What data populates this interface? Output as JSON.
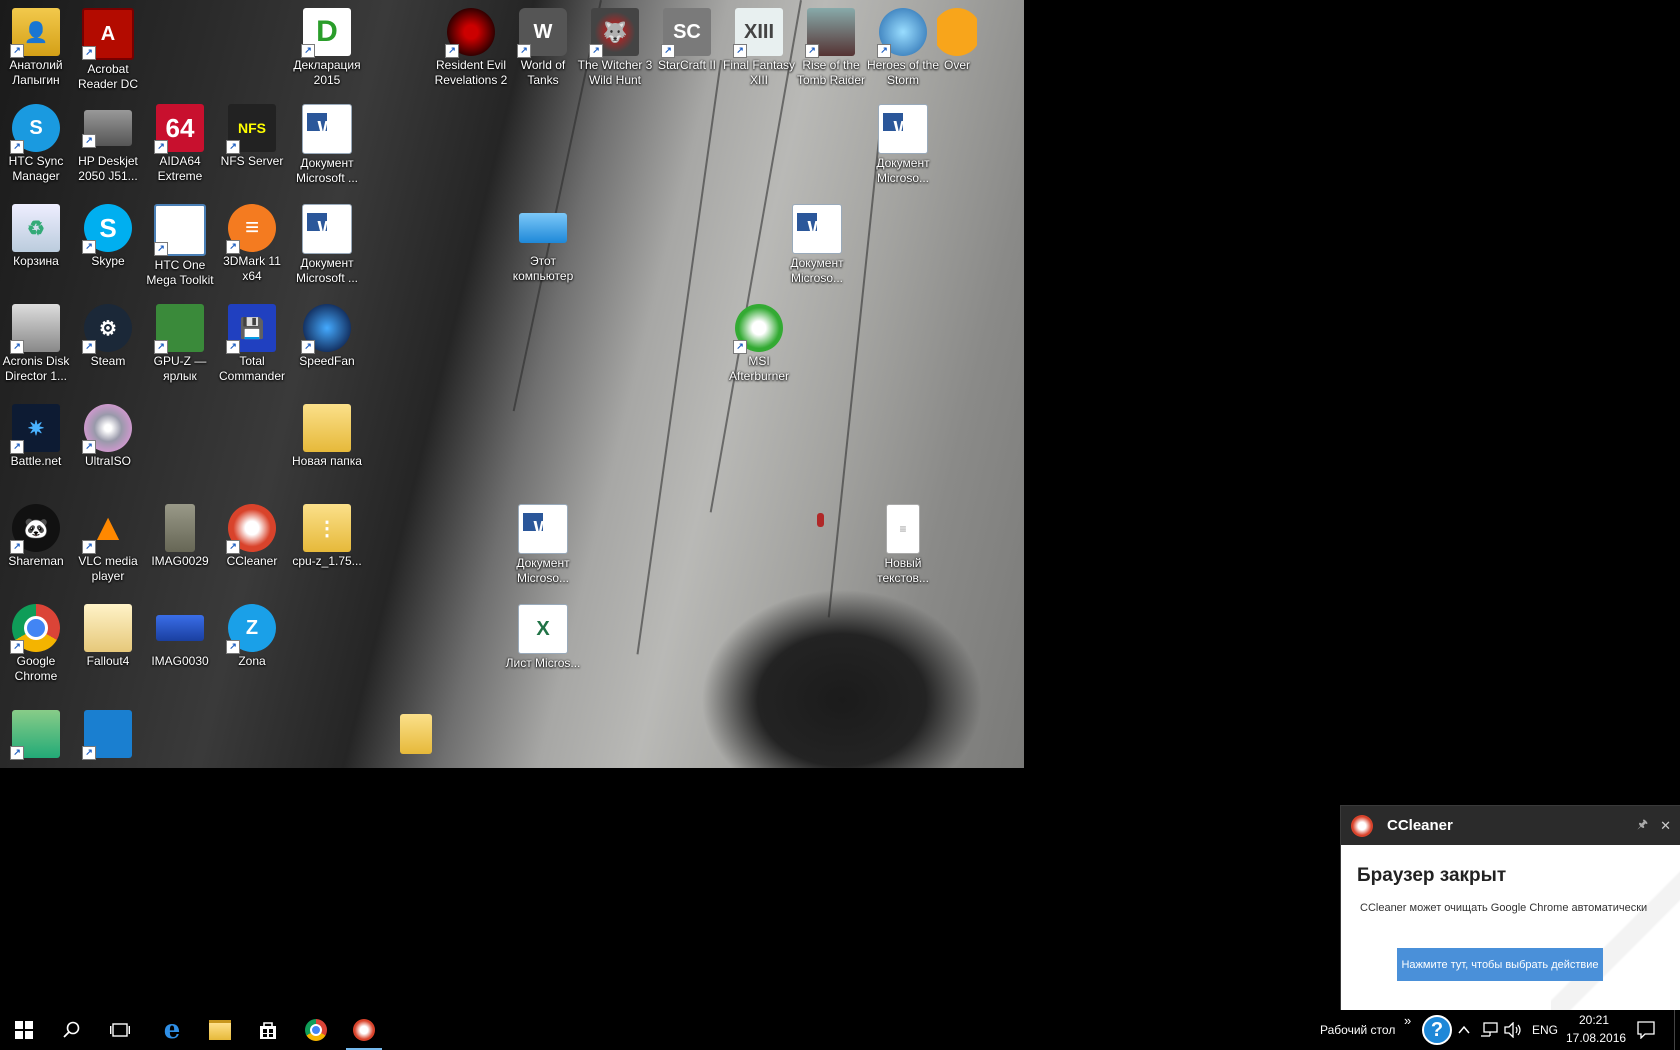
{
  "desktop": {
    "icons": [
      {
        "label": "Анатолий Лапыгин",
        "icon": "user-folder-icon"
      },
      {
        "label": "Acrobat Reader DC",
        "icon": "acrobat-icon"
      },
      {
        "label": "Декларация 2015",
        "icon": "declaration-icon"
      },
      {
        "label": "Resident Evil Revelations 2",
        "icon": "resident-evil-icon"
      },
      {
        "label": "World of Tanks",
        "icon": "world-of-tanks-icon"
      },
      {
        "label": "The Witcher 3 Wild Hunt",
        "icon": "witcher-icon"
      },
      {
        "label": "StarCraft II",
        "icon": "starcraft-icon"
      },
      {
        "label": "Final Fantasy XIII",
        "icon": "final-fantasy-icon"
      },
      {
        "label": "Rise of the Tomb Raider",
        "icon": "tomb-raider-icon"
      },
      {
        "label": "Heroes of the Storm",
        "icon": "heroes-of-the-storm-icon"
      },
      {
        "label": "Over",
        "icon": "overwatch-icon"
      },
      {
        "label": "HTC Sync Manager",
        "icon": "htc-sync-icon"
      },
      {
        "label": "HP Deskjet 2050 J51...",
        "icon": "printer-icon"
      },
      {
        "label": "AIDA64 Extreme",
        "icon": "aida64-icon"
      },
      {
        "label": "NFS Server",
        "icon": "nfs-server-icon"
      },
      {
        "label": "Документ Microsoft ...",
        "icon": "word-document-icon"
      },
      {
        "label": "Документ Microso...",
        "icon": "word-document-icon"
      },
      {
        "label": "Корзина",
        "icon": "recycle-bin-icon"
      },
      {
        "label": "Skype",
        "icon": "skype-icon"
      },
      {
        "label": "HTC One Mega Toolkit",
        "icon": "htc-toolkit-icon"
      },
      {
        "label": "3DMark 11 x64",
        "icon": "3dmark-icon"
      },
      {
        "label": "Документ Microsoft ...",
        "icon": "word-document-icon"
      },
      {
        "label": "Этот компьютер",
        "icon": "this-pc-icon"
      },
      {
        "label": "Документ Microso...",
        "icon": "word-document-icon"
      },
      {
        "label": "Acronis Disk Director 1...",
        "icon": "acronis-icon"
      },
      {
        "label": "Steam",
        "icon": "steam-icon"
      },
      {
        "label": "GPU-Z — ярлык",
        "icon": "gpu-z-icon"
      },
      {
        "label": "Total Commander",
        "icon": "total-commander-icon"
      },
      {
        "label": "SpeedFan",
        "icon": "speedfan-icon"
      },
      {
        "label": "MSI Afterburner",
        "icon": "msi-afterburner-icon"
      },
      {
        "label": "Battle.net",
        "icon": "battlenet-icon"
      },
      {
        "label": "UltraISO",
        "icon": "ultraiso-icon"
      },
      {
        "label": "Новая папка",
        "icon": "folder-icon"
      },
      {
        "label": "Shareman",
        "icon": "shareman-icon"
      },
      {
        "label": "VLC media player",
        "icon": "vlc-icon"
      },
      {
        "label": "IMAG0029",
        "icon": "image-file-icon"
      },
      {
        "label": "CCleaner",
        "icon": "ccleaner-icon"
      },
      {
        "label": "cpu-z_1.75...",
        "icon": "zip-folder-icon"
      },
      {
        "label": "Документ Microso...",
        "icon": "word-document-icon"
      },
      {
        "label": "Новый текстов...",
        "icon": "text-document-icon"
      },
      {
        "label": "Google Chrome",
        "icon": "chrome-icon"
      },
      {
        "label": "Fallout4",
        "icon": "folder-icon"
      },
      {
        "label": "IMAG0030",
        "icon": "image-file-icon"
      },
      {
        "label": "Zona",
        "icon": "zona-icon"
      },
      {
        "label": "Лист Micros...",
        "icon": "excel-sheet-icon"
      },
      {
        "label": "",
        "icon": "disk-cleanup-icon"
      },
      {
        "label": "",
        "icon": "remote-desktop-icon"
      },
      {
        "label": "",
        "icon": "folder-icon"
      }
    ]
  },
  "notification": {
    "app": "CCleaner",
    "title": "Браузер закрыт",
    "message": "CCleaner может очищать Google Chrome автоматически",
    "button": "Нажмите тут, чтобы выбрать действие",
    "pin_glyph": "🖈",
    "close_glyph": "✕"
  },
  "taskbar": {
    "apps": [
      "start-icon",
      "search-icon",
      "task-view-icon",
      "edge-icon",
      "file-explorer-icon",
      "store-icon",
      "chrome-icon",
      "ccleaner-icon"
    ],
    "desktop_toolbar": "Рабочий стол",
    "chevron": "»",
    "help_glyph": "?",
    "language": "ENG",
    "time": "20:21",
    "date": "17.08.2016"
  },
  "colors": {
    "accent_blue": "#4a90d9",
    "toast_header": "#2b2b2b",
    "ccleaner_red": "#d9432b"
  }
}
